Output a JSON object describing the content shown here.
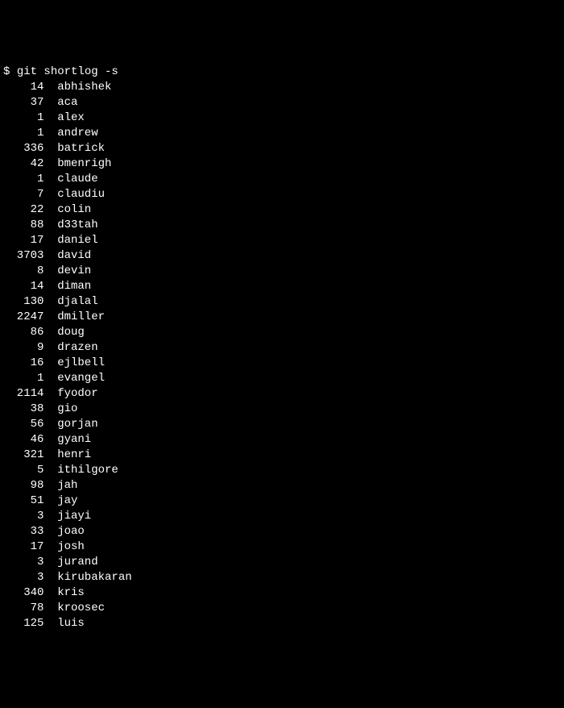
{
  "prompt": {
    "symbol": "$ ",
    "command": "git shortlog -s"
  },
  "rows": [
    {
      "count": "14",
      "name": "abhishek"
    },
    {
      "count": "37",
      "name": "aca"
    },
    {
      "count": "1",
      "name": "alex"
    },
    {
      "count": "1",
      "name": "andrew"
    },
    {
      "count": "336",
      "name": "batrick"
    },
    {
      "count": "42",
      "name": "bmenrigh"
    },
    {
      "count": "1",
      "name": "claude"
    },
    {
      "count": "7",
      "name": "claudiu"
    },
    {
      "count": "22",
      "name": "colin"
    },
    {
      "count": "88",
      "name": "d33tah"
    },
    {
      "count": "17",
      "name": "daniel"
    },
    {
      "count": "3703",
      "name": "david"
    },
    {
      "count": "8",
      "name": "devin"
    },
    {
      "count": "14",
      "name": "diman"
    },
    {
      "count": "130",
      "name": "djalal"
    },
    {
      "count": "2247",
      "name": "dmiller"
    },
    {
      "count": "86",
      "name": "doug"
    },
    {
      "count": "9",
      "name": "drazen"
    },
    {
      "count": "16",
      "name": "ejlbell"
    },
    {
      "count": "1",
      "name": "evangel"
    },
    {
      "count": "2114",
      "name": "fyodor"
    },
    {
      "count": "38",
      "name": "gio"
    },
    {
      "count": "56",
      "name": "gorjan"
    },
    {
      "count": "46",
      "name": "gyani"
    },
    {
      "count": "321",
      "name": "henri"
    },
    {
      "count": "5",
      "name": "ithilgore"
    },
    {
      "count": "98",
      "name": "jah"
    },
    {
      "count": "51",
      "name": "jay"
    },
    {
      "count": "3",
      "name": "jiayi"
    },
    {
      "count": "33",
      "name": "joao"
    },
    {
      "count": "17",
      "name": "josh"
    },
    {
      "count": "3",
      "name": "jurand"
    },
    {
      "count": "3",
      "name": "kirubakaran"
    },
    {
      "count": "340",
      "name": "kris"
    },
    {
      "count": "78",
      "name": "kroosec"
    },
    {
      "count": "125",
      "name": "luis"
    }
  ]
}
